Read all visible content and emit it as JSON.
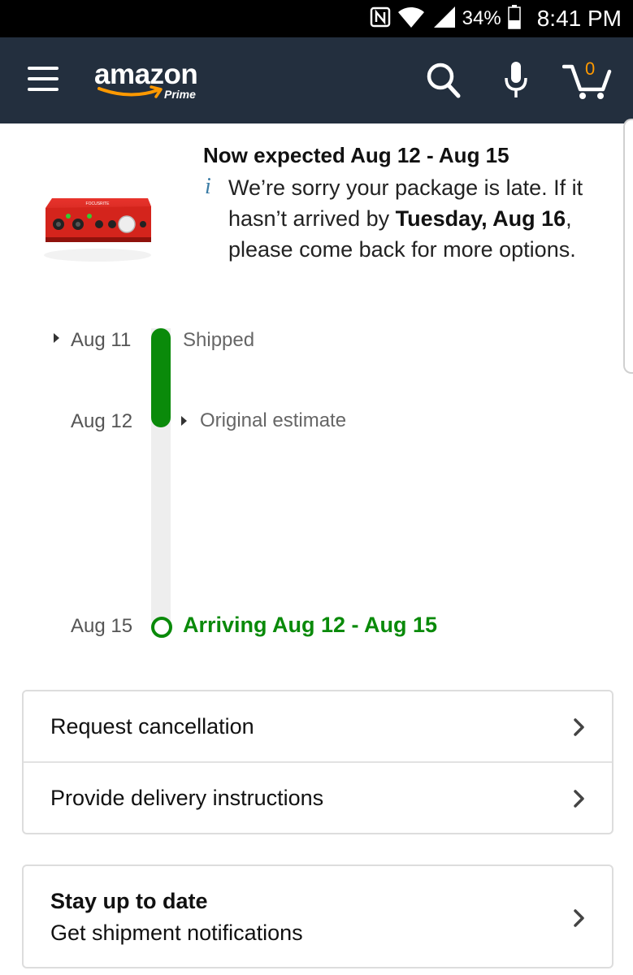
{
  "status_bar": {
    "battery_percent": "34%",
    "time": "8:41 PM",
    "icons": [
      "nfc-icon",
      "wifi-icon",
      "signal-icon",
      "battery-icon"
    ]
  },
  "header": {
    "logo_text": "amazon",
    "logo_sub": "Prime",
    "cart_count": "0",
    "icons": [
      "menu-icon",
      "search-icon",
      "microphone-icon",
      "cart-icon"
    ]
  },
  "shipment": {
    "headline": "Now expected Aug 12 - Aug 15",
    "message_part1": "We’re sorry your package is late. If it hasn’t arrived by ",
    "message_bold": "Tuesday, Aug 16",
    "message_part2": ", please come back for more options."
  },
  "timeline": {
    "shipped_date": "Aug 11",
    "shipped_label": "Shipped",
    "original_date": "Aug 12",
    "original_label": "Original estimate",
    "arriving_date": "Aug 15",
    "arriving_label": "Arriving Aug 12 - Aug 15",
    "progress_fraction": 0.33
  },
  "actions": {
    "request_cancellation": "Request cancellation",
    "delivery_instructions": "Provide delivery instructions",
    "stay_title": "Stay up to date",
    "stay_subtitle": "Get shipment notifications"
  },
  "colors": {
    "header_bg": "#232f3e",
    "progress_green": "#0a8a0a",
    "accent_orange": "#f90"
  }
}
